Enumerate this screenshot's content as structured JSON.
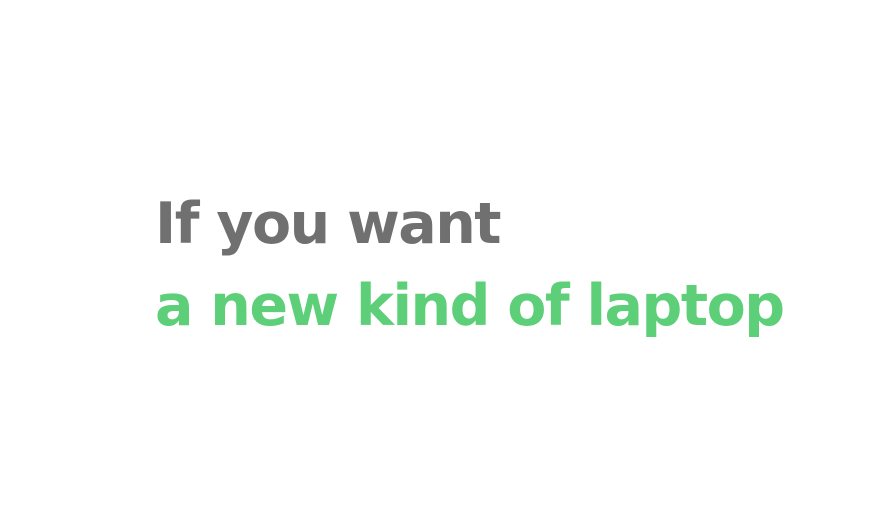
{
  "headline": {
    "line1": "If you want",
    "line2": "a new kind of laptop"
  },
  "colors": {
    "background": "#ffffff",
    "line1": "#707070",
    "line2": "#5ccf78"
  }
}
